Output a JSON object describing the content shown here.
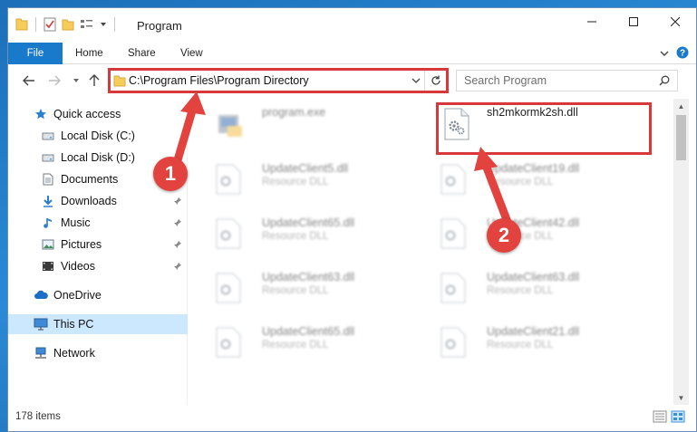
{
  "window": {
    "title": "Program"
  },
  "ribbon": {
    "tabs": [
      {
        "label": "File"
      },
      {
        "label": "Home"
      },
      {
        "label": "Share"
      },
      {
        "label": "View"
      }
    ]
  },
  "address": {
    "path": "C:\\Program Files\\Program Directory"
  },
  "search": {
    "placeholder": "Search Program"
  },
  "sidebar": {
    "items": [
      {
        "label": "Quick access",
        "icon": "star-icon"
      },
      {
        "label": "Local Disk (C:)",
        "icon": "drive-icon"
      },
      {
        "label": "Local Disk (D:)",
        "icon": "drive-icon"
      },
      {
        "label": "Documents",
        "icon": "documents-icon"
      },
      {
        "label": "Downloads",
        "icon": "download-icon"
      },
      {
        "label": "Music",
        "icon": "music-icon"
      },
      {
        "label": "Pictures",
        "icon": "pictures-icon"
      },
      {
        "label": "Videos",
        "icon": "video-icon"
      },
      {
        "label": "OneDrive",
        "icon": "cloud-icon"
      },
      {
        "label": "This PC",
        "icon": "computer-icon"
      },
      {
        "label": "Network",
        "icon": "network-icon"
      }
    ]
  },
  "files": {
    "program": {
      "name": "program.exe"
    },
    "target": {
      "name": "sh2mkormk2sh.dll"
    },
    "others": [
      {
        "name": "UpdateClient5.dll",
        "type": "Resource DLL"
      },
      {
        "name": "UpdateClient19.dll",
        "type": "Resource DLL"
      },
      {
        "name": "UpdateClient65.dll",
        "type": "Resource DLL"
      },
      {
        "name": "UpdateClient42.dll",
        "type": "Resource DLL"
      },
      {
        "name": "UpdateClient63.dll",
        "type": "Resource DLL"
      },
      {
        "name": "UpdateClient63.dll",
        "type": "Resource DLL"
      },
      {
        "name": "UpdateClient65.dll",
        "type": "Resource DLL"
      },
      {
        "name": "UpdateClient21.dll",
        "type": "Resource DLL"
      }
    ]
  },
  "status": {
    "count": "178 items"
  },
  "annotations": {
    "step1": "1",
    "step2": "2"
  },
  "colors": {
    "accent": "#1979ca",
    "highlight": "#d9383a",
    "selected": "#cce8ff"
  }
}
